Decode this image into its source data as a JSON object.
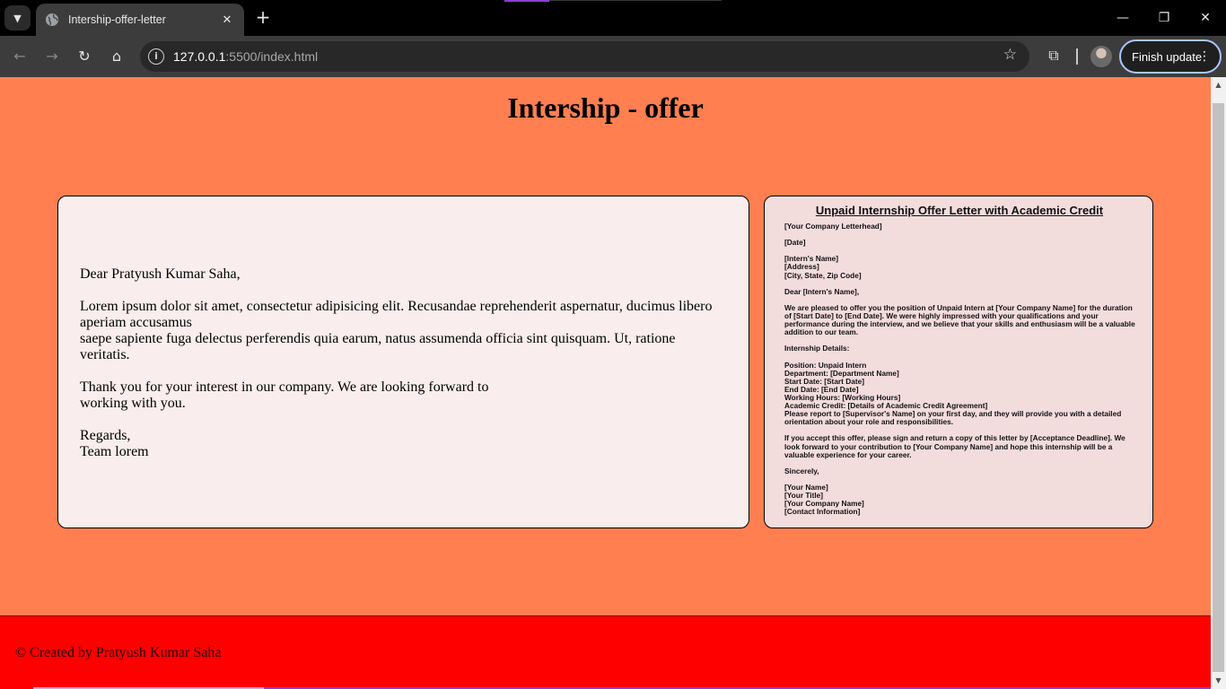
{
  "browser": {
    "tab": {
      "title": "Intership-offer-letter",
      "close_glyph": "✕",
      "favicon": "globe-icon"
    },
    "new_tab_glyph": "+",
    "window_controls": {
      "minimize": "—",
      "restore": "❐",
      "close": "✕"
    },
    "nav": {
      "back": "←",
      "forward": "→",
      "reload": "↻",
      "home": "⌂"
    },
    "address_bar": {
      "host": "127.0.0.1",
      "path": ":5500/index.html",
      "site_info_glyph": "i"
    },
    "bookmark_glyph": "☆",
    "extensions_glyph": "⧉",
    "finish_update": "Finish update",
    "menu_glyph": "⋮"
  },
  "page": {
    "heading": "Intership - offer",
    "letter": {
      "salutation": "Dear Pratyush Kumar Saha,",
      "body_line1": "Lorem ipsum dolor sit amet, consectetur adipisicing elit. Recusandae reprehenderit aspernatur, ducimus libero aperiam accusamus",
      "body_line2": "saepe sapiente fuga delectus perferendis quia earum, natus assumenda officia sint quisquam. Ut, ratione veritatis.",
      "thanks_line1": "Thank you for your interest in our company. We are looking forward to",
      "thanks_line2": "working with you.",
      "closing": "Regards,",
      "signature": "Team lorem"
    },
    "offer_doc": {
      "title": "Unpaid Internship Offer Letter with Academic Credit",
      "letterhead": "[Your Company Letterhead]",
      "date": "[Date]",
      "intern_name": "[Intern's Name]",
      "address": "[Address]",
      "city": "[City, State, Zip Code]",
      "greeting": "Dear [Intern's Name],",
      "intro": "We are pleased to offer you the position of Unpaid Intern at [Your Company Name] for the duration of [Start Date] to [End Date]. We were highly impressed with your qualifications and your performance during the interview, and we believe that your skills and enthusiasm will be a valuable addition to our team.",
      "details_heading": "Internship Details:",
      "position": "Position: Unpaid Intern",
      "department": "Department: [Department Name]",
      "start": "Start Date: [Start Date]",
      "end": "End Date: [End Date]",
      "hours": "Working Hours: [Working Hours]",
      "credit": "Academic Credit: [Details of Academic Credit Agreement]",
      "report": "Please report to [Supervisor's Name] on your first day, and they will provide you with a detailed orientation about your role and responsibilities.",
      "accept": "If you accept this offer, please sign and return a copy of this letter by [Acceptance Deadline]. We look forward to your contribution to [Your Company Name] and hope this internship will be a valuable experience for your career.",
      "sincerely": "Sincerely,",
      "your_name": "[Your Name]",
      "your_title": "[Your Title]",
      "company_name": "[Your Company Name]",
      "contact": "[Contact Information]"
    },
    "footer": "© Created by Pratyush Kumar Saha"
  }
}
